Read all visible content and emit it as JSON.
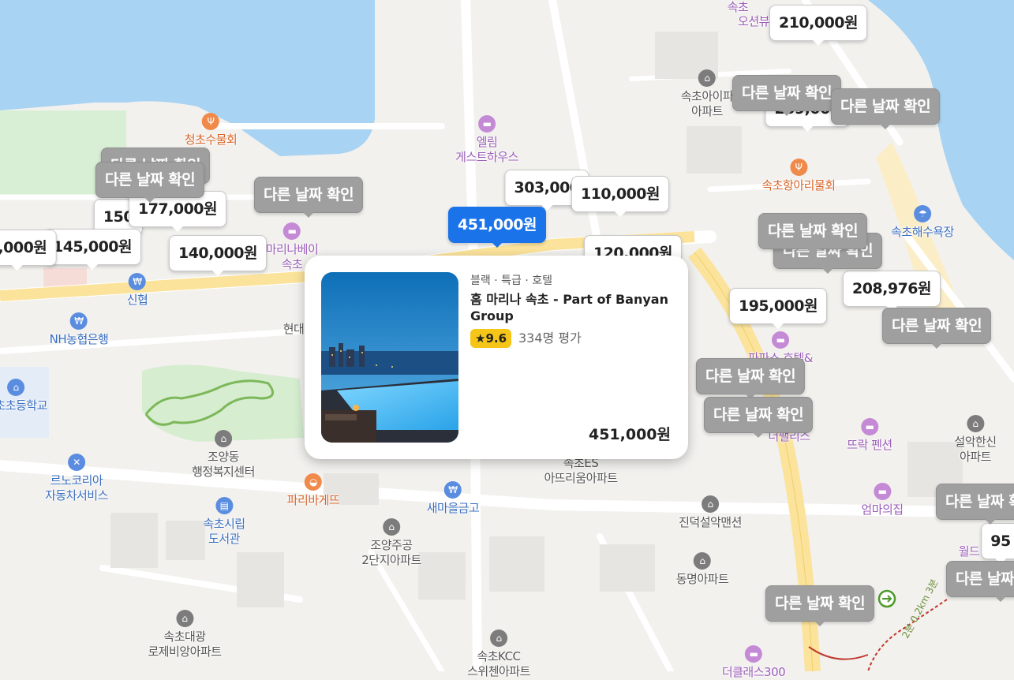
{
  "colors": {
    "water": "#a9d3f2",
    "road": "#ffffff",
    "major_road": "#fbe39b",
    "selected": "#1a73e8",
    "sold_out": "#9f9f9f"
  },
  "pois": [
    {
      "name": "orange-label",
      "lines": "오션뷰",
      "cls": "purple",
      "icon": ""
    },
    {
      "name": "sokcho-label",
      "lines": "속초",
      "cls": "purple",
      "icon": ""
    },
    {
      "name": "poi-sokcho-ipark",
      "lines": "속초아이파\n아파트",
      "cls": "gray",
      "icon": "building-icon"
    },
    {
      "name": "poi-cheongcho-sashimi",
      "lines": "청초수물회",
      "cls": "orange",
      "icon": "restaurant-icon"
    },
    {
      "name": "poi-elim-guesthouse",
      "lines": "엘림\n게스트하우스",
      "cls": "purple",
      "icon": "bed-icon"
    },
    {
      "name": "poi-sokcho-hang-ari",
      "lines": "속초항아리물회",
      "cls": "orange",
      "icon": "restaurant-icon"
    },
    {
      "name": "poi-sokcho-beach",
      "lines": "속초해수욕장",
      "cls": "blue",
      "icon": "beach-icon"
    },
    {
      "name": "poi-marinabay",
      "lines": "마리나베이\n속초",
      "cls": "purple",
      "icon": "bed-icon"
    },
    {
      "name": "poi-shinhyup",
      "lines": "신협",
      "cls": "blue",
      "icon": "bank-icon"
    },
    {
      "name": "poi-nh-bank",
      "lines": "NH농협은행",
      "cls": "blue",
      "icon": "bank-icon"
    },
    {
      "name": "poi-hyeon",
      "lines": "현대",
      "cls": "gray",
      "icon": ""
    },
    {
      "name": "poi-elementary",
      "lines": "속초초등학교",
      "cls": "blue",
      "icon": "school-icon"
    },
    {
      "name": "poi-joyang-office",
      "lines": "조양동\n행정복지센터",
      "cls": "gray",
      "icon": "government-icon"
    },
    {
      "name": "poi-renocorea",
      "lines": "르노코리아\n자동차서비스",
      "cls": "blue",
      "icon": "wrench-icon"
    },
    {
      "name": "poi-paris-baguette",
      "lines": "파리바게뜨",
      "cls": "orange",
      "icon": "bakery-icon"
    },
    {
      "name": "poi-saemaeul",
      "lines": "새마을금고",
      "cls": "blue",
      "icon": "bank-icon"
    },
    {
      "name": "poi-es-atrium",
      "lines": "속초ES\n아뜨리움아파트",
      "cls": "gray",
      "icon": ""
    },
    {
      "name": "poi-jindeok",
      "lines": "진덕설악맨션",
      "cls": "gray",
      "icon": "building-icon"
    },
    {
      "name": "poi-library",
      "lines": "속초시립\n도서관",
      "cls": "blue",
      "icon": "book-icon"
    },
    {
      "name": "poi-joyang-jugong",
      "lines": "조양주공\n2단지아파트",
      "cls": "gray",
      "icon": "building-icon"
    },
    {
      "name": "poi-dongmyeong",
      "lines": "동명아파트",
      "cls": "gray",
      "icon": "building-icon"
    },
    {
      "name": "poi-papas-hotel",
      "lines": "파파스 호텔&\n속초",
      "cls": "purple",
      "icon": "bed-icon"
    },
    {
      "name": "poi-the-palace",
      "lines": "더팰리스",
      "cls": "purple",
      "icon": ""
    },
    {
      "name": "poi-ttrak-pension",
      "lines": "뜨락 펜션",
      "cls": "purple",
      "icon": "bed-icon"
    },
    {
      "name": "poi-seorak-hanshin",
      "lines": "설악한신\n아파트",
      "cls": "gray",
      "icon": "building-icon"
    },
    {
      "name": "poi-eomma-uijip",
      "lines": "엄마의집",
      "cls": "purple",
      "icon": "bed-icon"
    },
    {
      "name": "poi-sokcho-daegwang",
      "lines": "속초대광\n로제비앙아파트",
      "cls": "gray",
      "icon": "building-icon"
    },
    {
      "name": "poi-sokcho-kcc",
      "lines": "속초KCC\n스위첸아파트",
      "cls": "gray",
      "icon": "building-icon"
    },
    {
      "name": "poi-the-class",
      "lines": "더클래스300",
      "cls": "purple",
      "icon": "bed-icon"
    },
    {
      "name": "poi-world",
      "lines": "월드",
      "cls": "purple",
      "icon": ""
    }
  ],
  "pins": [
    {
      "name": "price-pin-210000",
      "label": "210,000원",
      "state": "price"
    },
    {
      "name": "price-pin-259000",
      "label": "259,000",
      "state": "price"
    },
    {
      "name": "price-pin-303000",
      "label": "303,000",
      "state": "price"
    },
    {
      "name": "price-pin-110000",
      "label": "110,000원",
      "state": "price"
    },
    {
      "name": "price-pin-120000",
      "label": "120,000원",
      "state": "price"
    },
    {
      "name": "price-pin-150",
      "label": "150",
      "state": "price"
    },
    {
      "name": "price-pin-177000",
      "label": "177,000원",
      "state": "price"
    },
    {
      "name": "price-pin-145000",
      "label": "145,000원",
      "state": "price"
    },
    {
      "name": "price-pin-140000",
      "label": "140,000원",
      "state": "price"
    },
    {
      "name": "price-pin-edge",
      "label": "0,000원",
      "state": "price"
    },
    {
      "name": "price-pin-195000",
      "label": "195,000원",
      "state": "price"
    },
    {
      "name": "price-pin-208976",
      "label": "208,976원",
      "state": "price"
    },
    {
      "name": "price-pin-95",
      "label": "95",
      "state": "price"
    },
    {
      "name": "sold-out-pin",
      "label": "다른 날짜 확인",
      "state": "gray"
    },
    {
      "name": "selected-price-pin",
      "label": "451,000원",
      "state": "selected"
    }
  ],
  "card": {
    "category": "블랙 · 특급 · 호텔",
    "name": "홈 마리나 속초 - Part of Banyan Group",
    "score": "9.6",
    "reviews": "334명 평가",
    "price": "451,000원",
    "score_icon": "star-icon",
    "photo_icon": "hotel-photo"
  },
  "route_icon": "route-start-icon",
  "trail_label": "2분 0.2km 3분"
}
